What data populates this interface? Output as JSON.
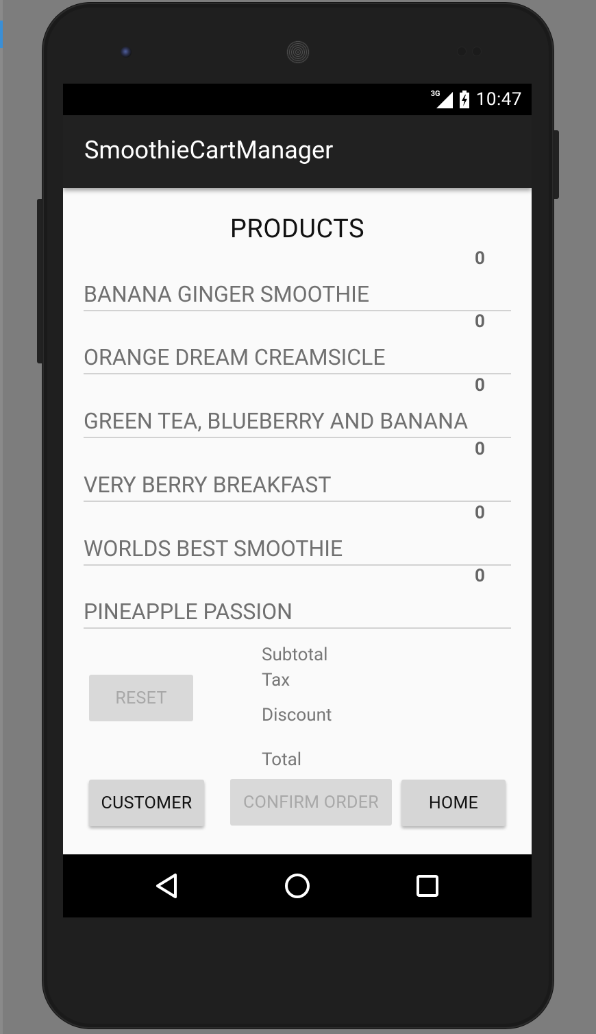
{
  "status_bar": {
    "network_label": "3G",
    "time": "10:47"
  },
  "action_bar": {
    "title": "SmoothieCartManager"
  },
  "main": {
    "heading": "PRODUCTS",
    "products": [
      {
        "name": "BANANA GINGER SMOOTHIE",
        "quantity": "0"
      },
      {
        "name": "ORANGE DREAM CREAMSICLE",
        "quantity": "0"
      },
      {
        "name": "GREEN TEA, BLUEBERRY AND BANANA",
        "quantity": "0"
      },
      {
        "name": "VERY BERRY BREAKFAST",
        "quantity": "0"
      },
      {
        "name": "WORLDS BEST SMOOTHIE",
        "quantity": "0"
      },
      {
        "name": "PINEAPPLE PASSION",
        "quantity": "0"
      }
    ],
    "summary": {
      "subtotal_label": "Subtotal",
      "tax_label": "Tax",
      "discount_label": "Discount",
      "total_label": "Total"
    },
    "buttons": {
      "reset": "RESET",
      "customer": "CUSTOMER",
      "confirm_order": "CONFIRM ORDER",
      "home": "HOME"
    }
  },
  "nav_bar": {
    "icons": [
      "back-icon",
      "home-icon",
      "recents-icon"
    ]
  },
  "colors": {
    "background": "#7d7d7d",
    "phone_body": "#1f1f1f",
    "action_bar": "#212121",
    "screen": "#fafafa",
    "button": "#d6d6d6",
    "muted_text": "#707070"
  }
}
